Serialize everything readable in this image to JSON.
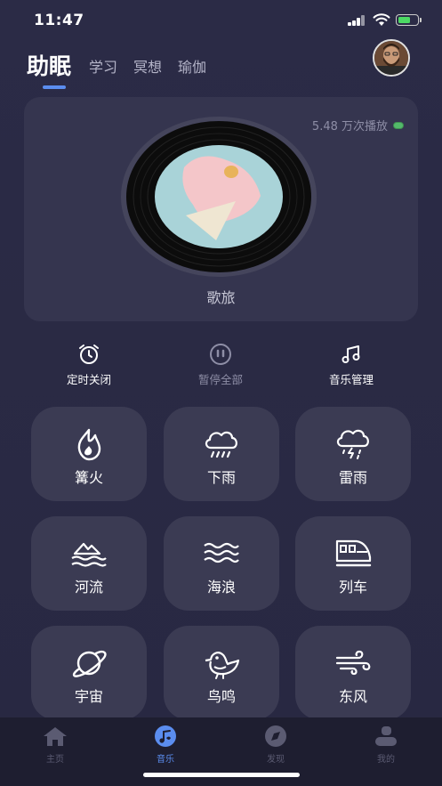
{
  "status_bar": {
    "time": "11:47"
  },
  "tabs": [
    {
      "label": "助眠",
      "active": true
    },
    {
      "label": "学习",
      "active": false
    },
    {
      "label": "冥想",
      "active": false
    },
    {
      "label": "瑜伽",
      "active": false
    }
  ],
  "player": {
    "play_count": "5.48 万次播放",
    "song_name": "歌旅"
  },
  "controls": {
    "timer_label": "定时关闭",
    "pause_all_label": "暂停全部",
    "music_manage_label": "音乐管理"
  },
  "sounds": [
    {
      "label": "篝火",
      "icon": "bonfire-icon"
    },
    {
      "label": "下雨",
      "icon": "rain-icon"
    },
    {
      "label": "雷雨",
      "icon": "thunderstorm-icon"
    },
    {
      "label": "河流",
      "icon": "river-icon"
    },
    {
      "label": "海浪",
      "icon": "waves-icon"
    },
    {
      "label": "列车",
      "icon": "train-icon"
    },
    {
      "label": "宇宙",
      "icon": "planet-icon"
    },
    {
      "label": "鸟鸣",
      "icon": "bird-icon"
    },
    {
      "label": "东风",
      "icon": "wind-icon"
    }
  ],
  "bottom_nav": [
    {
      "label": "主页",
      "icon": "home-icon",
      "active": false
    },
    {
      "label": "音乐",
      "icon": "music-icon",
      "active": true
    },
    {
      "label": "发现",
      "icon": "compass-icon",
      "active": false
    },
    {
      "label": "我的",
      "icon": "profile-icon",
      "active": false
    }
  ],
  "colors": {
    "accent": "#5b8def",
    "background": "#282840",
    "card": "#35354f",
    "tile": "#3b3b53",
    "online_dot": "#53b96a"
  }
}
